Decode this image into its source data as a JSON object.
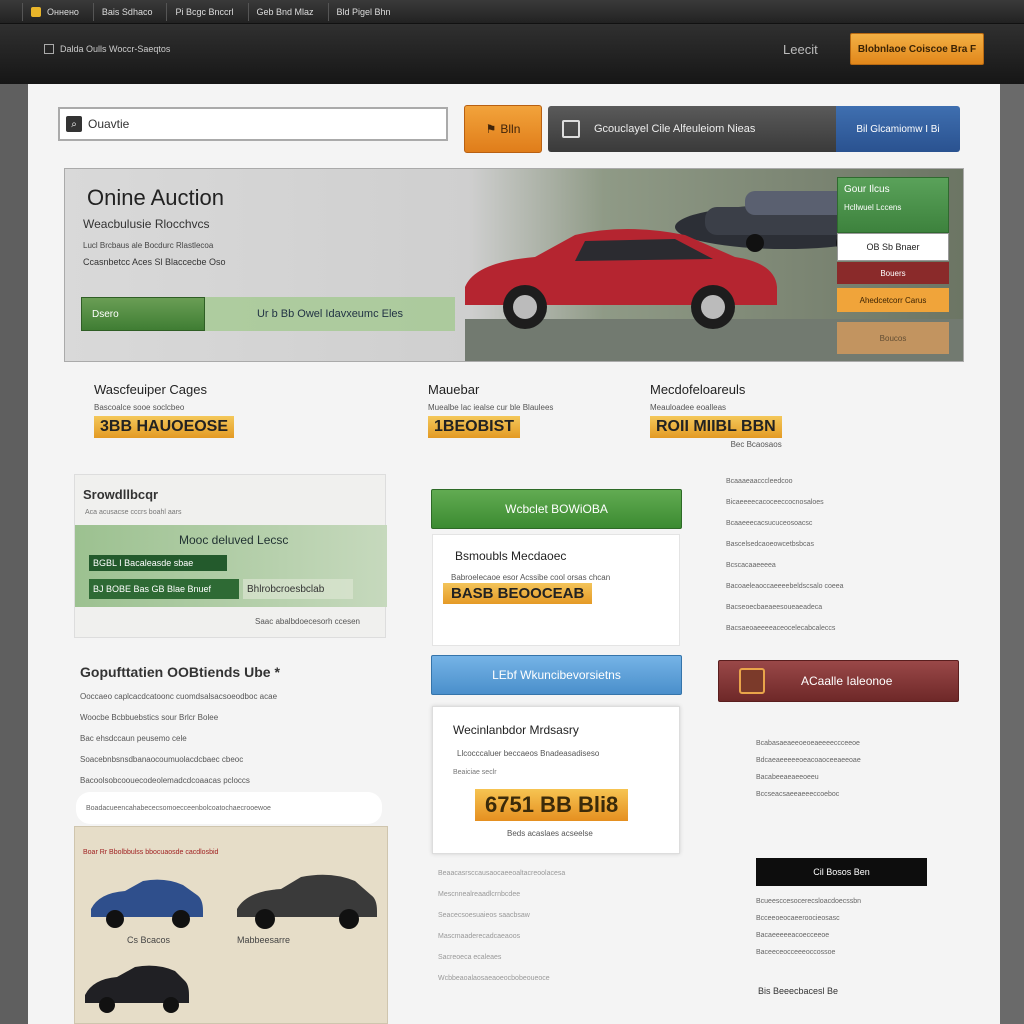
{
  "browser": {
    "tabs": [
      {
        "label": "Оннено"
      },
      {
        "label": "Bais  Sdhaco"
      },
      {
        "label": "Pi Bcgc Bnccrl"
      },
      {
        "label": "Geb  Bnd  Mlaz"
      },
      {
        "label": "Bld  Pigel  Bhn"
      }
    ]
  },
  "header": {
    "breadcrumb": "Dalda Oulls Woccr-Saeqtos",
    "link": "Leecit",
    "cta": "Blobnlaoe Coiscoe Bra F"
  },
  "search": {
    "value": "Ouavtie"
  },
  "go_button": {
    "label": "Blln"
  },
  "navbar": {
    "main": "Gcouclayel Cile Alfeuleiom Nieas",
    "side": "Bil Glcamiomw I Bi"
  },
  "hero": {
    "title": "Onine Auction",
    "subtitle": "Weacbulusie Rlocchvcs",
    "line2": "Lucl Brcbaus ale Bocdurc Rlastlecoa",
    "line3": "Ccasnbetcc Aces   Sl   Blaccecbe Oso",
    "button": "Dsero",
    "tag": "Ur b Bb  Owel  Idavxeumc  Eles",
    "panel": {
      "top_title": "Gour Ilcus",
      "top_sub": "Hcllwuel Lccens",
      "box": "OB  Sb  Bnaer",
      "red": "Bouers",
      "orange": "Ahedcetcorr Carus",
      "faded": "Boucos"
    }
  },
  "stats": [
    {
      "title": "Wascfeuiper Cages",
      "sub": "Bascoalce sooe soclcbeo",
      "value": "3BB  HAUOEOSE",
      "foot": ""
    },
    {
      "title": "Mauebar",
      "sub": "Muealbe lac iealse cur ble Blaulees",
      "value": "1BEOBIST",
      "foot": ""
    },
    {
      "title": "Mecdofeloareuls",
      "sub": "Meauloadee eoalleas",
      "value": "ROII  MIIBL  BBN",
      "foot": "Bec Bcaosaos"
    }
  ],
  "left": {
    "card_title": "Srowdllbcqr",
    "card_sub": "Aca acusacse cccrs boahl aars",
    "green_title": "Mooc deluved Lecsc",
    "green_row1": "BGBL  I  Bacaleasde sbae",
    "green_row2": "BJ  BOBE  Bas  GB  Blae Bnuef",
    "green_tag": "Bhlrobcroesbclab",
    "card_foot": "Saac abalbdoecesorh ccesen",
    "text_title": "Gopufttatien  OOBtiends  Ube *",
    "text_lines": [
      "Ooccaeo caplcacdcatoonc cuomdsalsacsoeodboc acae",
      "Woocbe Bcbbuebstics sour Brlcr Bolee",
      "Bac ehsdccaun peusemo cele",
      "Soacebnbsnsdbanaocoumuolacdcbaec cbeoc",
      "Bacoolsobcoouecodeolemadcdcoaacas pcloccs"
    ],
    "bar_text": "Boadacueencahabececsomoecceenbolcoatochaecrooewoe",
    "gallery_head": "Boar  Rr  Bbolbbulss  bbocuaosde  cacdlosbid",
    "gallery_caps": [
      "Cs Bcacos",
      "Mabbeesarre"
    ]
  },
  "middle": {
    "green_btn": "Wcbclet  BOWiOBA",
    "card1_title": "Bsmoubls  Mecdaoec",
    "card1_sub": "Babroelecaoe esor Acssibe cool orsas chcan",
    "card1_value": "BASB  BEOOCEAB",
    "blue_btn": "LEbf  Wkuncibevorsietns",
    "card2_title": "Wecinlanbdor  Mrdsasry",
    "card2_sub": "Llcocccaluer beccaeos  Bnadeasadiseso",
    "card2_sub2": "Beaiciae  seclr",
    "card2_value": "6751  BB  Bli8",
    "card2_foot": "Beds  acaslaes  acseelse",
    "lines": [
      "Beaacasrsccausaocaeeoaltacreoolacesa",
      "Mescnnealreaadlcrnbcdee",
      "Seacecsoesuaieos saacbsaw",
      "Mascmaaderecadcaeaoos",
      "Sacreoeca ecaleaes",
      "Wcbbeaoalaosaeaoeocbobeoueoce"
    ]
  },
  "right": {
    "lines": [
      "Bcaaaeaacccleedcoo",
      "Bicaeeeecacoceeccocnosaloes",
      "Bcaaeeecacsucuceosoacsc",
      "Bascelsedcaoeowcetbsbcas",
      "Bcscacaaeeeea",
      "Bacoaeleaoccaeeeebeldscsalo coeea",
      "Bacseoecbaeaeesoueaeadeca",
      "Bacsaeoaeeeeaceocelecabcaleccs"
    ],
    "red_btn": "ACaalle Ialeonoe",
    "lines2": [
      "Bcabasaeaeeoeoeaeeeeccceeoe",
      "Bdcaeaeeeeeoeacoaoceeaeeoae",
      "Bacabeeaeaeeoeeu",
      "Bccseacsaeeaeeeccoeboc"
    ],
    "black_btn": "Cil  Bosos  Ben",
    "lines3": [
      "Bcueesccesocerecsloacdoecssbn",
      "Bcceeoeocaeeroocieosasc",
      "Bacaeeeeeacoecceeoe",
      "Baceeceocceeeoccossoe"
    ],
    "last": "Bis  Beeecbacesl  Be"
  }
}
